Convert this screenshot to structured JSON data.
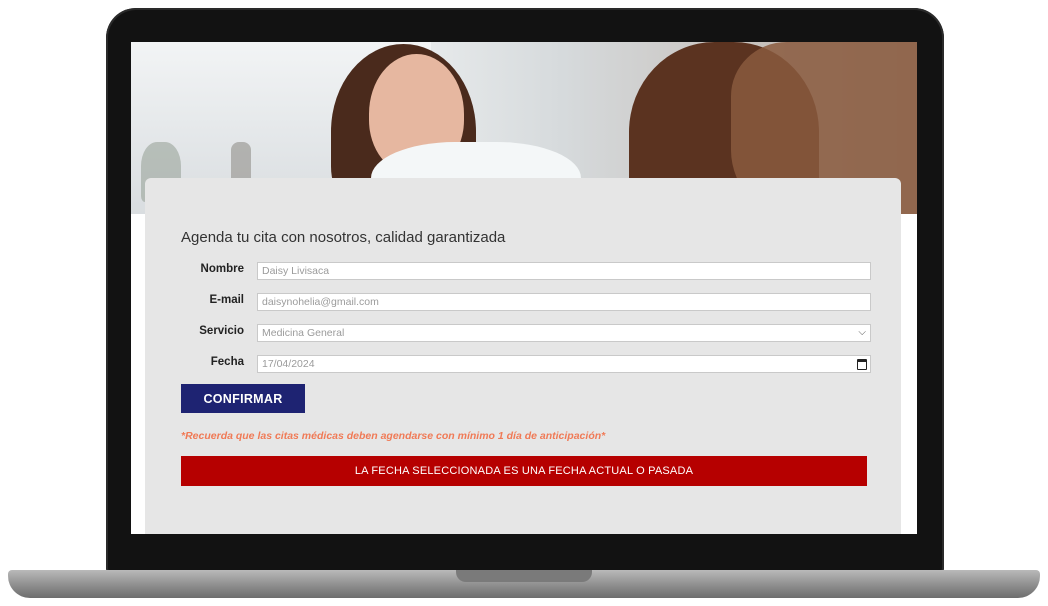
{
  "form": {
    "heading": "Agenda tu cita con nosotros, calidad garantizada",
    "fields": [
      {
        "label": "Nombre",
        "value": "Daisy Livisaca"
      },
      {
        "label": "E-mail",
        "value": "daisynohelia@gmail.com"
      },
      {
        "label": "Servicio",
        "value": "Medicina General"
      },
      {
        "label": "Fecha",
        "value": "17/04/2024"
      }
    ],
    "confirm_label": "CONFIRMAR",
    "notice": "*Recuerda que las citas médicas deben agendarse con mínimo 1 día de anticipación*",
    "error": "LA FECHA SELECCIONADA ES UNA FECHA ACTUAL O PASADA",
    "service_dropdown_glyph": "⌵"
  },
  "colors": {
    "confirm_button": "#1e2372",
    "error_banner": "#b60000",
    "notice_text": "#f07a56",
    "card_background": "#e6e6e6"
  },
  "icons": {
    "service_select": "chevron-down-icon",
    "date_picker": "calendar-icon"
  }
}
